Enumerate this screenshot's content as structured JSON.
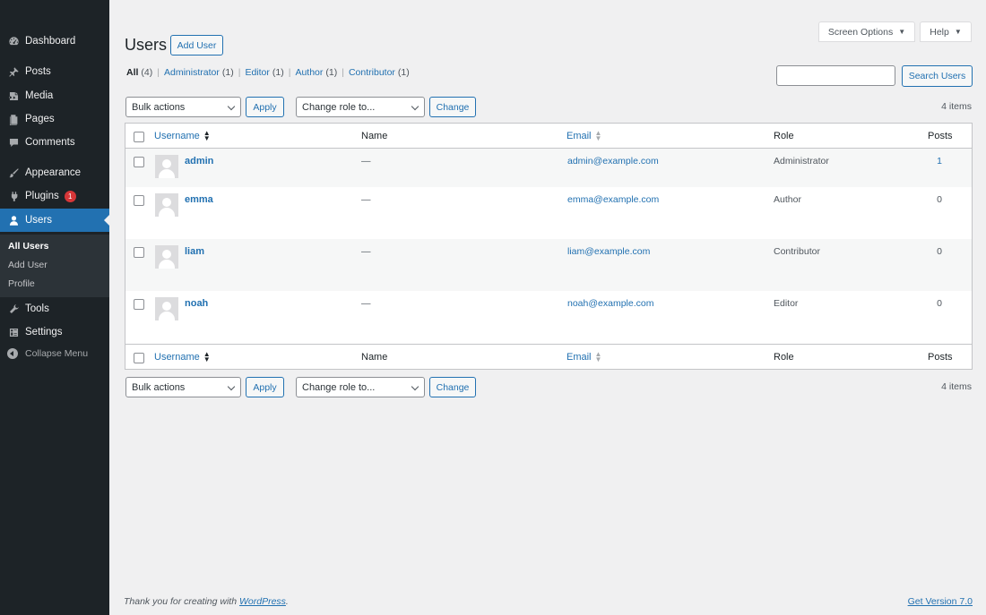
{
  "sidebar": {
    "items": [
      {
        "label": "Dashboard",
        "icon": "dashboard-icon"
      },
      {
        "label": "Posts",
        "icon": "pushpin-icon"
      },
      {
        "label": "Media",
        "icon": "media-icon"
      },
      {
        "label": "Pages",
        "icon": "pages-icon"
      },
      {
        "label": "Comments",
        "icon": "comments-icon"
      },
      {
        "label": "Appearance",
        "icon": "appearance-brush-icon"
      },
      {
        "label": "Plugins",
        "icon": "plugins-icon",
        "badge": "1"
      },
      {
        "label": "Users",
        "icon": "users-icon",
        "current": true
      },
      {
        "label": "Tools",
        "icon": "tools-wrench-icon"
      },
      {
        "label": "Settings",
        "icon": "settings-icon"
      }
    ],
    "submenu": [
      "All Users",
      "Add User",
      "Profile"
    ],
    "collapse_label": "Collapse Menu"
  },
  "top": {
    "screen_options": "Screen Options",
    "help": "Help",
    "caret": "▼"
  },
  "header": {
    "title": "Users",
    "add_user": "Add User"
  },
  "filters": [
    {
      "label": "All",
      "count": "(4)",
      "current": true
    },
    {
      "label": "Administrator",
      "count": "(1)"
    },
    {
      "label": "Editor",
      "count": "(1)"
    },
    {
      "label": "Author",
      "count": "(1)"
    },
    {
      "label": "Contributor",
      "count": "(1)"
    }
  ],
  "filter_separator": "|",
  "search": {
    "value": "",
    "button": "Search Users"
  },
  "tablenav": {
    "bulk_actions": "Bulk actions",
    "apply": "Apply",
    "change_role": "Change role to...",
    "change": "Change",
    "items_count": "4 items"
  },
  "table": {
    "columns": {
      "username": "Username",
      "name": "Name",
      "email": "Email",
      "role": "Role",
      "posts": "Posts"
    },
    "rows": [
      {
        "username": "admin",
        "name": "—",
        "email": "admin@example.com",
        "role": "Administrator",
        "posts": "1"
      },
      {
        "username": "emma",
        "name": "—",
        "email": "emma@example.com",
        "role": "Author",
        "posts": "0"
      },
      {
        "username": "liam",
        "name": "—",
        "email": "liam@example.com",
        "role": "Contributor",
        "posts": "0"
      },
      {
        "username": "noah",
        "name": "—",
        "email": "noah@example.com",
        "role": "Editor",
        "posts": "0"
      }
    ]
  },
  "footer": {
    "thanks_prefix": "Thank you for creating with ",
    "thanks_link": "WordPress",
    "thanks_suffix": ".",
    "version": "Get Version 7.0"
  },
  "colors": {
    "sidebar_bg": "#1d2327",
    "accent": "#2271b1",
    "badge": "#d63638",
    "page_bg": "#f0f0f1"
  }
}
